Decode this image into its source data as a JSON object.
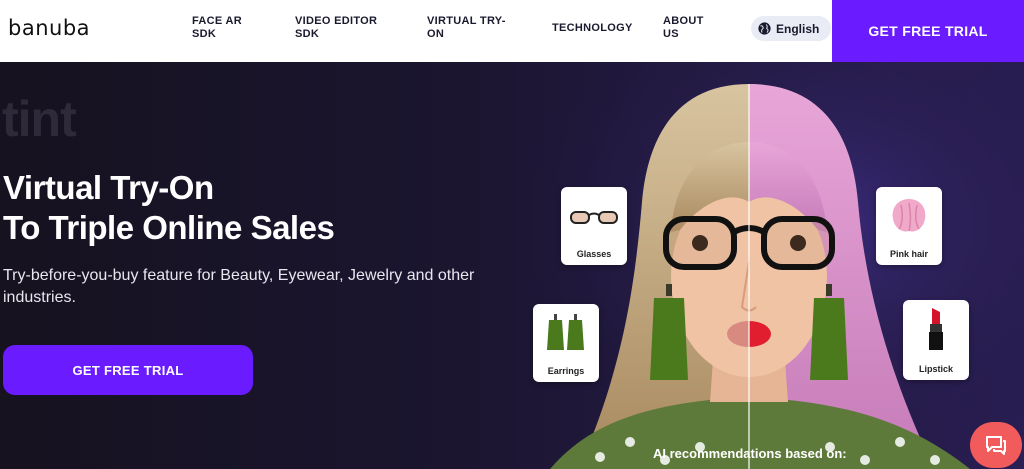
{
  "header": {
    "logo": "banuba",
    "nav": [
      {
        "label_1": "FACE AR",
        "label_2": "SDK"
      },
      {
        "label_1": "VIDEO EDITOR",
        "label_2": "SDK"
      },
      {
        "label_1": "VIRTUAL TRY-",
        "label_2": "ON"
      },
      {
        "label_1": "TECHNOLOGY",
        "label_2": ""
      },
      {
        "label_1": "ABOUT",
        "label_2": "US"
      }
    ],
    "language": "English",
    "cta": "GET FREE TRIAL"
  },
  "hero": {
    "rotating_word": "tint",
    "title_line1": "Virtual Try-On",
    "title_line2": "To Triple Online Sales",
    "subtitle": "Try-before-you-buy feature for Beauty, Eyewear, Jewelry and other industries.",
    "cta": "GET FREE TRIAL",
    "products": [
      {
        "label": "Glasses",
        "icon": "glasses-icon"
      },
      {
        "label": "Earrings",
        "icon": "earrings-icon"
      },
      {
        "label": "Pink hair",
        "icon": "hair-swatch-icon"
      },
      {
        "label": "Lipstick",
        "icon": "lipstick-icon"
      }
    ],
    "ai_recommendations": "AI recommendations based on:"
  },
  "colors": {
    "brand_purple": "#6a1bff",
    "hero_bg": "#1b1530",
    "chat_button": "#f15b5b"
  }
}
